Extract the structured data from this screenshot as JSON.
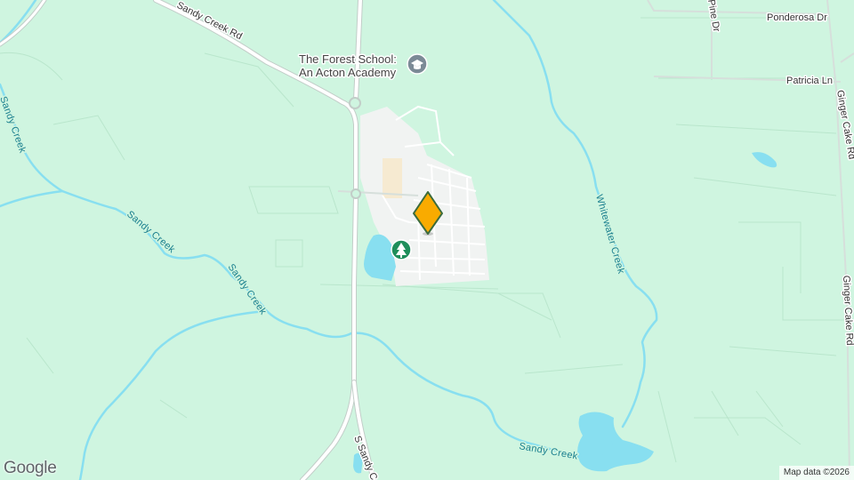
{
  "roads": {
    "sandy_creek_rd": "Sandy Creek Rd",
    "s_sandy_creek": "S Sandy C",
    "ponderosa_dr": "Ponderosa Dr",
    "patricia_ln": "Patricia Ln",
    "ginger_cake_rd_top": "Ginger Cake Rd",
    "ginger_cake_rd_bottom": "Ginger Cake Rd",
    "pine_dr": "Pine Dr"
  },
  "water": {
    "sandy_creek_a": "Sandy Creek",
    "sandy_creek_b": "Sandy Creek",
    "sandy_creek_c": "Sandy Creek",
    "sandy_creek_d": "Sandy Creek",
    "whitewater_creek": "Whitewater Creek"
  },
  "poi": {
    "school_line1": "The Forest School:",
    "school_line2": "An Acton Academy",
    "school_icon": "graduation-cap-icon",
    "park_icon": "tree-icon"
  },
  "marker": {
    "icon": "location-marker-icon",
    "color": "#f9ab00",
    "outline": "#3b6b3b"
  },
  "colors": {
    "land": "#cff5e0",
    "water": "#88dff0",
    "creek_label": "#1a7f8e",
    "urban": "#f1f3f2",
    "school_icon_bg": "#7b8a96",
    "park_icon_bg": "#1e8e5a"
  },
  "footer": {
    "logo": "Google",
    "attribution": "Map data ©2026"
  }
}
